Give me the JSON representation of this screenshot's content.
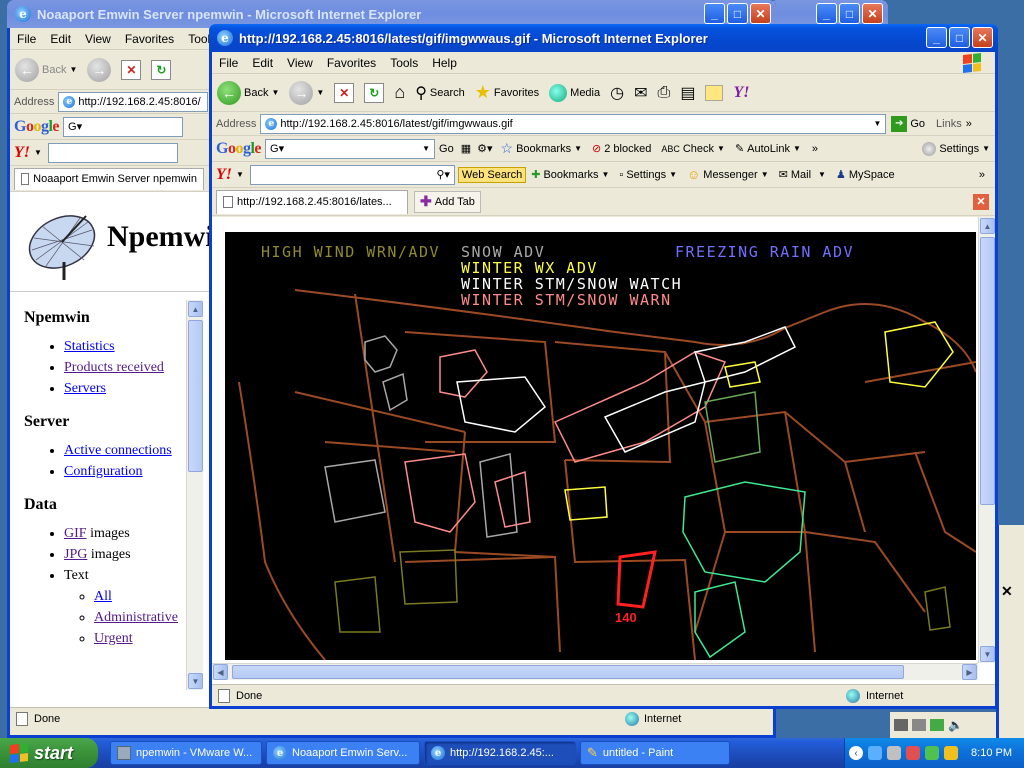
{
  "back_window": {
    "title": "Noaaport Emwin Server npemwin - Microsoft Internet Explorer",
    "menu": [
      "File",
      "Edit",
      "View",
      "Favorites",
      "Tools"
    ],
    "back_label": "Back",
    "address_label": "Address",
    "address": "http://192.168.2.45:8016/",
    "tab": "Noaaport Emwin Server npemwin",
    "site_title": "Npemwin",
    "sections": [
      {
        "heading": "Npemwin",
        "links": [
          "Statistics",
          "Products received",
          "Servers"
        ]
      },
      {
        "heading": "Server",
        "links": [
          "Active connections",
          "Configuration"
        ]
      }
    ],
    "data_heading": "Data",
    "data_items": [
      {
        "link": "GIF",
        "text": " images"
      },
      {
        "link": "JPG",
        "text": " images"
      },
      {
        "link": "",
        "text": "Text"
      }
    ],
    "text_sublinks": [
      "All",
      "Administrative",
      "Urgent"
    ],
    "status": "Done",
    "zone": "Internet"
  },
  "main_window": {
    "title": "http://192.168.2.45:8016/latest/gif/imgwwaus.gif - Microsoft Internet Explorer",
    "menu": [
      "File",
      "Edit",
      "View",
      "Favorites",
      "Tools",
      "Help"
    ],
    "toolbar": {
      "back": "Back",
      "search": "Search",
      "favorites": "Favorites",
      "media": "Media"
    },
    "address_label": "Address",
    "address": "http://192.168.2.45:8016/latest/gif/imgwwaus.gif",
    "go_label": "Go",
    "links_label": "Links",
    "google_bar": {
      "go": "Go",
      "bookmarks": "Bookmarks",
      "blocked": "2 blocked",
      "check": "Check",
      "autolink": "AutoLink",
      "settings": "Settings"
    },
    "yahoo_bar": {
      "web_search": "Web Search",
      "bookmarks": "Bookmarks",
      "settings": "Settings",
      "messenger": "Messenger",
      "mail": "Mail",
      "myspace": "MySpace"
    },
    "tab": "http://192.168.2.45:8016/lates...",
    "add_tab": "Add Tab",
    "status": "Done",
    "zone": "Internet"
  },
  "map": {
    "legend": [
      {
        "text": "HIGH WIND WRN/ADV",
        "color": "#8f8a2e"
      },
      {
        "text": "SNOW ADV",
        "color": "#a8a8a8"
      },
      {
        "text": "FREEZING RAIN ADV",
        "color": "#7070ff"
      },
      {
        "text": "WINTER WX ADV",
        "color": "#ffff40"
      },
      {
        "text": "WINTER STM/SNOW WATCH",
        "color": "#ffffff"
      },
      {
        "text": "WINTER STM/SNOW WARN",
        "color": "#ff8a8a"
      }
    ],
    "watch_label": "140",
    "colors": {
      "background": "#000000",
      "borders": "#9b4a24",
      "green_region": "#40e890",
      "olive_region": "#7a7a20",
      "watch_box": "#ff2020"
    }
  },
  "taskbar": {
    "start": "start",
    "tasks": [
      "npemwin - VMware W...",
      "Noaaport Emwin Serv...",
      "http://192.168.2.45:...",
      "untitled - Paint"
    ],
    "clock": "8:10 PM"
  }
}
